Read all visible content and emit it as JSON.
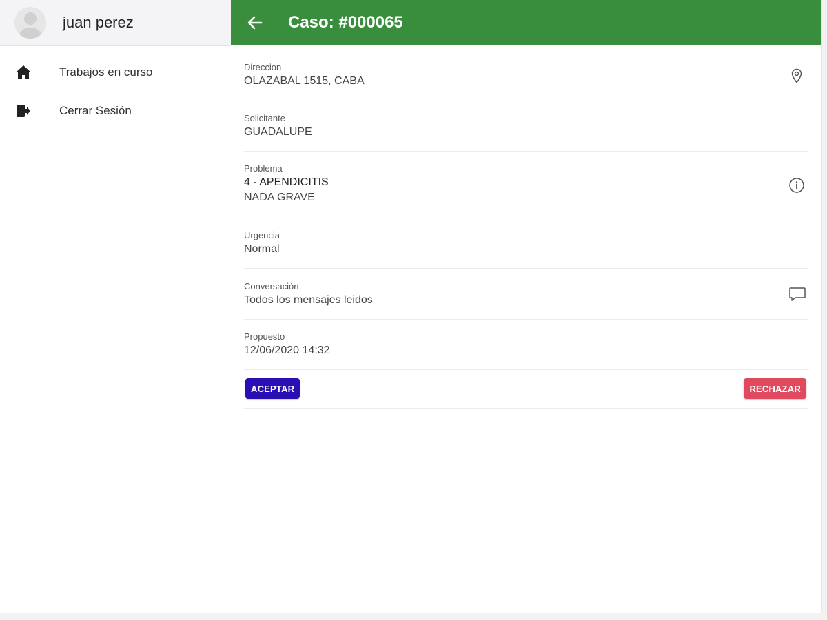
{
  "sidebar": {
    "user_name": "juan perez",
    "avatar_icon": "person-avatar-icon",
    "items": [
      {
        "label": "Trabajos en curso",
        "icon": "home-icon"
      },
      {
        "label": "Cerrar Sesión",
        "icon": "logout-icon"
      }
    ]
  },
  "header": {
    "title": "Caso: #000065",
    "back_icon": "arrow-left-icon",
    "color": "#388e3c"
  },
  "details": {
    "direccion": {
      "label": "Direccion",
      "value": "OLAZABAL 1515, CABA",
      "icon": "map-pin-icon"
    },
    "solicitante": {
      "label": "Solicitante",
      "value": "GUADALUPE"
    },
    "problema": {
      "label": "Problema",
      "value": "4 - APENDICITIS",
      "detail": "NADA GRAVE",
      "icon": "info-icon"
    },
    "urgencia": {
      "label": "Urgencia",
      "value": "Normal"
    },
    "conversacion": {
      "label": "Conversación",
      "value": "Todos los mensajes leidos",
      "icon": "chat-bubble-icon"
    },
    "propuesto": {
      "label": "Propuesto",
      "value": "12/06/2020 14:32"
    }
  },
  "actions": {
    "accept_label": "ACEPTAR",
    "reject_label": "RECHAZAR",
    "accept_color": "#2a0fb5",
    "reject_color": "#e04a5e"
  }
}
